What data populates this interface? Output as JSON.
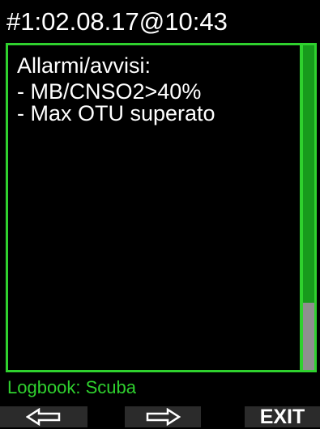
{
  "header": {
    "title": "#1:02.08.17@10:43"
  },
  "panel": {
    "title": "Allarmi/avvisi:",
    "alarms": [
      "- MB/CNSO2>40%",
      "- Max OTU superato"
    ],
    "scroll_position_fraction": 0.79
  },
  "footer": {
    "mode_label": "Logbook: Scuba",
    "softkeys": {
      "left_icon": "arrow-left-icon",
      "middle_icon": "arrow-right-icon",
      "right_label": "EXIT"
    }
  },
  "colors": {
    "accent_green": "#2fd12e",
    "scrollbar_green": "#179b1c",
    "thumb_gray": "#8f8f8f",
    "softkey_bg": "#2b2b2b",
    "background": "#000000",
    "text": "#ffffff"
  }
}
